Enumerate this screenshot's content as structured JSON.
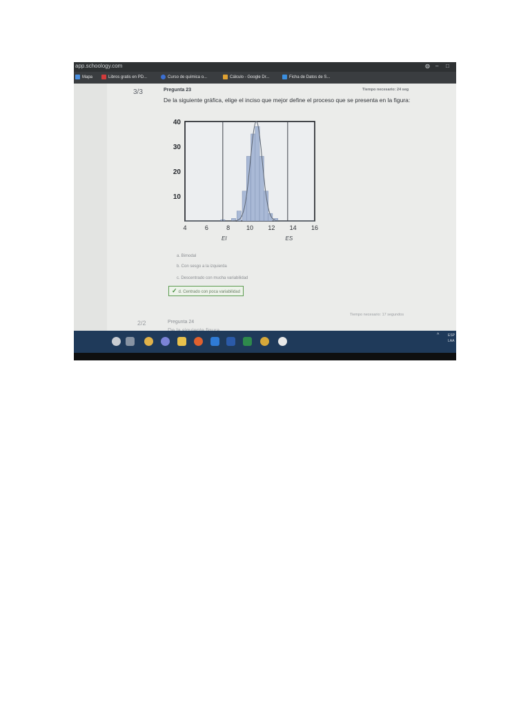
{
  "browser": {
    "url": "app.schoology.com",
    "bookmarks": [
      {
        "label": "Mapa",
        "icon": "map-icon",
        "color": "#4a8fe0"
      },
      {
        "label": "Libros gratis en PD...",
        "icon": "book-icon",
        "color": "#d23b3b"
      },
      {
        "label": "Curso de química o...",
        "icon": "course-icon",
        "color": "#3b6fd2"
      },
      {
        "label": "Cálculo - Google Dr...",
        "icon": "drive-icon",
        "color": "#e0a132"
      },
      {
        "label": "Ficha de Datos de S...",
        "icon": "sheet-icon",
        "color": "#3b8fe0"
      }
    ]
  },
  "question23": {
    "score": "3/3",
    "label": "Pregunta 23",
    "time": "Tiempo necesario: 24 seg",
    "text": "De la siguiente gráfica, elige el inciso que mejor define el proceso que se presenta en la figura:",
    "options": [
      {
        "label": "a. Bimodal",
        "correct": false
      },
      {
        "label": "b. Con sesgo a la izquierda",
        "correct": false
      },
      {
        "label": "c. Descentrado con mucha variabilidad",
        "correct": false
      },
      {
        "label": "d. Centrado con poca variabilidad",
        "correct": true
      }
    ]
  },
  "question24": {
    "score": "2/2",
    "label": "Pregunta 24",
    "time": "Tiempo necesario: 17 segundos",
    "text": "De la siguiente figura"
  },
  "taskbar": {
    "right_text": "ESP LAA",
    "icons": [
      "start-icon",
      "taskview-icon",
      "weather-icon",
      "teams-icon",
      "files-icon",
      "firefox-icon",
      "outlook-icon",
      "word-icon",
      "excel-icon",
      "chrome-icon",
      "timer-icon"
    ]
  },
  "chart_data": {
    "type": "bar",
    "title": "",
    "xlabel": "",
    "ylabel": "",
    "x_ticks": [
      4,
      6,
      8,
      10,
      12,
      14,
      16
    ],
    "y_ticks": [
      10,
      20,
      30,
      40
    ],
    "xlim": [
      4,
      16
    ],
    "ylim": [
      0,
      40
    ],
    "bins": [
      {
        "x": 7.5,
        "value": 0.5
      },
      {
        "x": 8.5,
        "value": 1
      },
      {
        "x": 9.0,
        "value": 4
      },
      {
        "x": 9.5,
        "value": 12
      },
      {
        "x": 9.9,
        "value": 26
      },
      {
        "x": 10.3,
        "value": 35
      },
      {
        "x": 10.7,
        "value": 38
      },
      {
        "x": 11.1,
        "value": 26
      },
      {
        "x": 11.5,
        "value": 12
      },
      {
        "x": 11.9,
        "value": 3
      },
      {
        "x": 12.4,
        "value": 1
      }
    ],
    "curve": {
      "mean": 10.6,
      "sd": 0.55,
      "peak": 40
    },
    "reference_lines": [
      {
        "label": "EI",
        "x": 7.5
      },
      {
        "label": "ES",
        "x": 13.5
      }
    ],
    "bar_color": "#a9b9d6",
    "curve_color": "#5c6470",
    "grid": false
  }
}
